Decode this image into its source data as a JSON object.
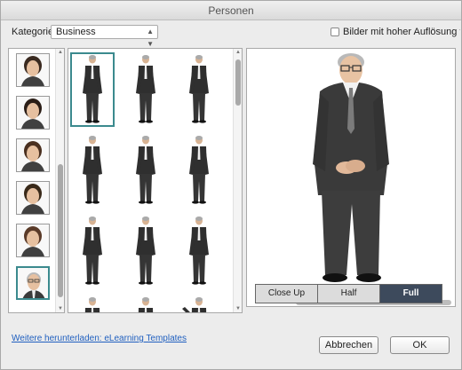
{
  "window": {
    "title": "Personen"
  },
  "category": {
    "label": "Kategorie:",
    "value": "Business"
  },
  "high_res": {
    "label": "Bilder mit hoher Auflösung verwe",
    "checked": false
  },
  "headshots": [
    {
      "name": "woman-1",
      "selected": false
    },
    {
      "name": "woman-2",
      "selected": false
    },
    {
      "name": "woman-3",
      "selected": false
    },
    {
      "name": "woman-headset",
      "selected": false
    },
    {
      "name": "woman-5",
      "selected": false
    },
    {
      "name": "man-grey-hair",
      "selected": true
    }
  ],
  "poses": [
    {
      "pose": "hands-clasped",
      "selected": true
    },
    {
      "pose": "arms-crossed",
      "selected": false
    },
    {
      "pose": "hand-on-chin",
      "selected": false
    },
    {
      "pose": "hands-in-pockets",
      "selected": false
    },
    {
      "pose": "pointing",
      "selected": false
    },
    {
      "pose": "holding-jacket",
      "selected": false
    },
    {
      "pose": "standing",
      "selected": false
    },
    {
      "pose": "walking",
      "selected": false
    },
    {
      "pose": "pointing-side",
      "selected": false
    },
    {
      "pose": "partial-1",
      "selected": false
    },
    {
      "pose": "partial-2",
      "selected": false
    },
    {
      "pose": "partial-3",
      "selected": false
    }
  ],
  "view_mode": {
    "options": [
      "Close Up",
      "Half",
      "Full"
    ],
    "selected": "Full"
  },
  "footer": {
    "link": "Weitere herunterladen: eLearning Templates",
    "cancel": "Abbrechen",
    "ok": "OK"
  },
  "colors": {
    "selection": "#3b8a8e",
    "active_segment": "#3d4a5c",
    "link": "#1f5fbf"
  }
}
